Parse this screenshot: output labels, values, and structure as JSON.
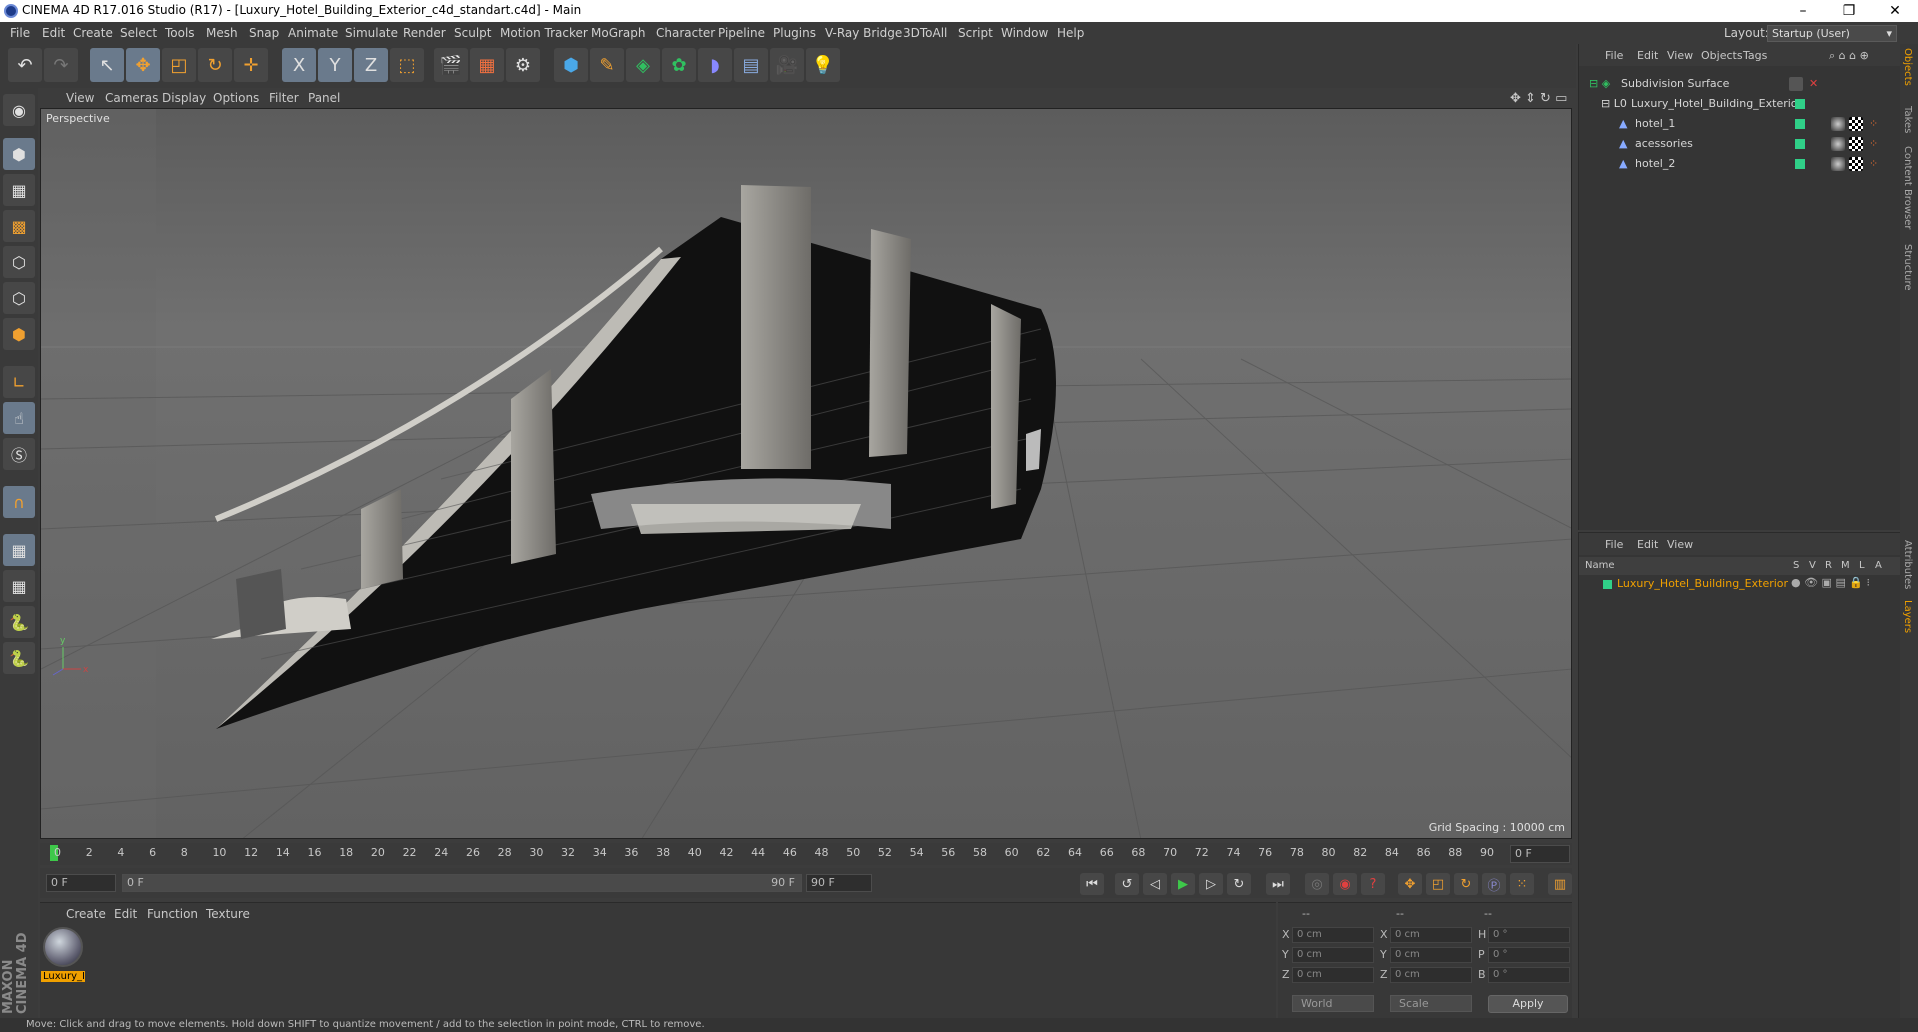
{
  "window": {
    "title": "CINEMA 4D R17.016 Studio (R17) - [Luxury_Hotel_Building_Exterior_c4d_standart.c4d] - Main",
    "minimize": "–",
    "restore": "❐",
    "close": "✕"
  },
  "menu": [
    "File",
    "Edit",
    "Create",
    "Select",
    "Tools",
    "Mesh",
    "Snap",
    "Animate",
    "Simulate",
    "Render",
    "Sculpt",
    "Motion Tracker",
    "MoGraph",
    "Character",
    "Pipeline",
    "Plugins",
    "V-Ray Bridge",
    "3DToAll",
    "Script",
    "Window",
    "Help"
  ],
  "layout": {
    "label": "Layout:",
    "value": "Startup (User)"
  },
  "toolbar": {
    "icons": [
      "undo-icon",
      "redo-icon",
      "live-select-icon",
      "move-icon",
      "scale-icon",
      "rotate-icon",
      "recent-tool-icon",
      "x-axis-icon",
      "y-axis-icon",
      "z-axis-icon",
      "coordinate-system-icon",
      "render-view-icon",
      "render-picture-viewer-icon",
      "edit-render-settings-icon",
      "cube-icon",
      "pen-spline-icon",
      "subdivision-icon",
      "mograph-cloner-icon",
      "deformer-icon",
      "floor-icon",
      "camera-icon",
      "light-icon"
    ],
    "axis_labels": [
      "X",
      "Y",
      "Z"
    ]
  },
  "viewport": {
    "menu": [
      "View",
      "Cameras",
      "Display",
      "Options",
      "Filter",
      "Panel"
    ],
    "label": "Perspective",
    "grid_spacing": "Grid Spacing : 10000 cm"
  },
  "timeline": {
    "ticks": [
      "0",
      "2",
      "4",
      "6",
      "8",
      "10",
      "12",
      "14",
      "16",
      "18",
      "20",
      "22",
      "24",
      "26",
      "28",
      "30",
      "32",
      "34",
      "36",
      "38",
      "40",
      "42",
      "44",
      "46",
      "48",
      "50",
      "52",
      "54",
      "56",
      "58",
      "60",
      "62",
      "64",
      "66",
      "68",
      "70",
      "72",
      "74",
      "76",
      "78",
      "80",
      "82",
      "84",
      "86",
      "88",
      "90"
    ],
    "current_frame": "0 F",
    "start": "0 F",
    "range_start": "0 F",
    "range_end": "90 F",
    "end": "90 F"
  },
  "material_manager": {
    "menu": [
      "Create",
      "Edit",
      "Function",
      "Texture"
    ],
    "materials": [
      {
        "name": "Luxury_I"
      }
    ]
  },
  "coordinates": {
    "header": [
      "--",
      "--",
      "--"
    ],
    "rows": [
      {
        "a": "X",
        "av": "0 cm",
        "b": "X",
        "bv": "0 cm",
        "c": "H",
        "cv": "0 °"
      },
      {
        "a": "Y",
        "av": "0 cm",
        "b": "Y",
        "bv": "0 cm",
        "c": "P",
        "cv": "0 °"
      },
      {
        "a": "Z",
        "av": "0 cm",
        "b": "Z",
        "bv": "0 cm",
        "c": "B",
        "cv": "0 °"
      }
    ],
    "mode": "World",
    "type": "Scale",
    "apply": "Apply"
  },
  "object_manager": {
    "menu": [
      "File",
      "Edit",
      "View",
      "Objects",
      "Tags"
    ],
    "objects": [
      {
        "name": "Subdivision Surface"
      },
      {
        "name": "Luxury_Hotel_Building_Exterior"
      },
      {
        "name": "hotel_1"
      },
      {
        "name": "acessories"
      },
      {
        "name": "hotel_2"
      }
    ]
  },
  "layer_manager": {
    "menu": [
      "File",
      "Edit",
      "View"
    ],
    "columns": [
      "Name",
      "S",
      "V",
      "R",
      "M",
      "L",
      "A"
    ],
    "layers": [
      {
        "name": "Luxury_Hotel_Building_Exterior"
      }
    ]
  },
  "right_tabs": [
    "Objects",
    "Takes",
    "Content Browser",
    "Structure",
    "Attributes",
    "Layers"
  ],
  "branding": "MAXON CINEMA 4D",
  "status": "Move: Click and drag to move elements. Hold down SHIFT to quantize movement / add to the selection in point mode, CTRL to remove.",
  "colors": {
    "accent": "#f0a000",
    "green": "#30d088"
  }
}
